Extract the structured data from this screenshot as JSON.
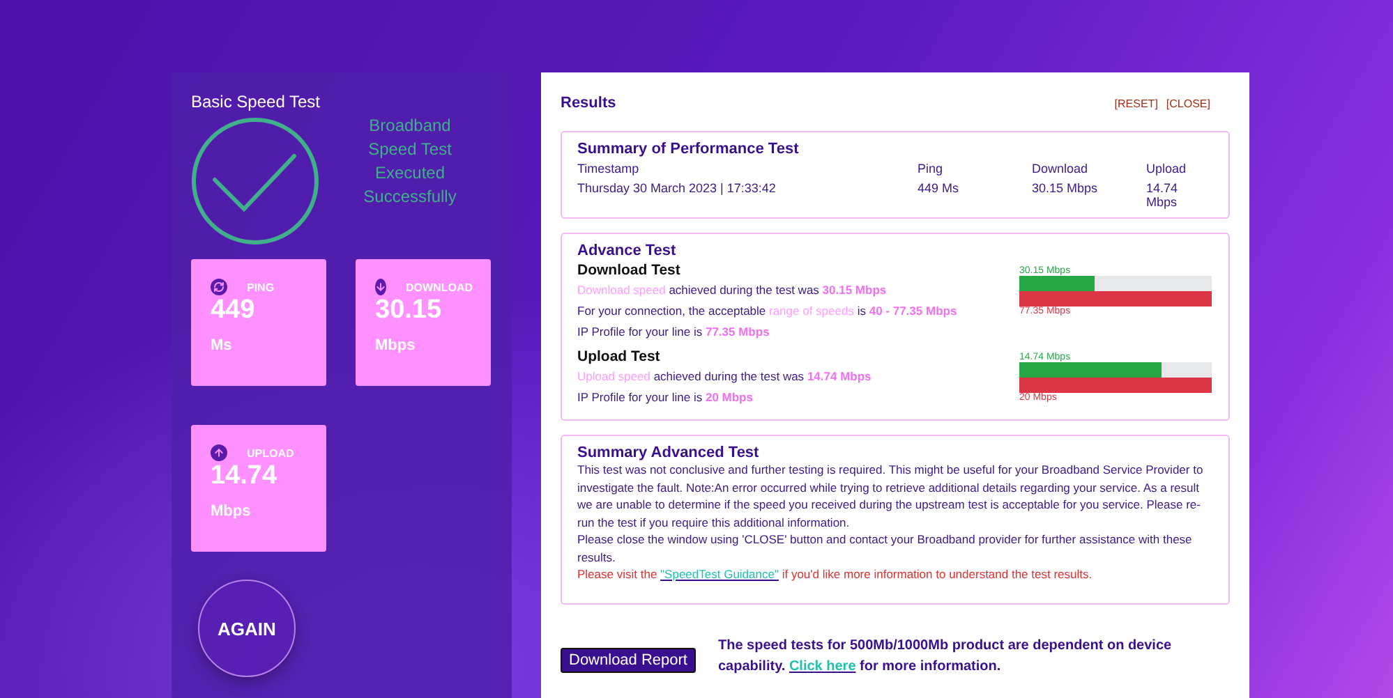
{
  "basic": {
    "title": "Basic Speed Test",
    "status_lines": [
      "Broadband",
      "Speed Test",
      "Executed",
      "Successfully"
    ],
    "tiles": [
      {
        "kind": "ping",
        "label": "PING",
        "value": "449",
        "unit": "Ms"
      },
      {
        "kind": "download",
        "label": "DOWNLOAD",
        "value": "30.15",
        "unit": "Mbps"
      },
      {
        "kind": "upload",
        "label": "UPLOAD",
        "value": "14.74",
        "unit": "Mbps"
      }
    ],
    "again_button": "AGAIN"
  },
  "results": {
    "title": "Results",
    "actions": [
      "[RESET]",
      "[CLOSE]"
    ],
    "summary": {
      "title": "Summary of Performance Test",
      "columns": [
        "Timestamp",
        "Ping",
        "Download",
        "Upload"
      ],
      "values": [
        "Thursday 30 March 2023 | 17:33:42",
        "449 Ms",
        "30.15 Mbps",
        "14.74 Mbps"
      ]
    },
    "advance": {
      "title": "Advance Test",
      "tests": [
        {
          "title": "Download Test",
          "lines": [
            [
              {
                "kind": "soft",
                "text": "Download speed"
              },
              {
                "kind": "plain",
                "text": " achieved during the test was "
              },
              {
                "kind": "value",
                "text": "30.15 Mbps"
              }
            ],
            [
              {
                "kind": "plain",
                "text": "For your connection, the acceptable "
              },
              {
                "kind": "soft",
                "text": "range of speeds"
              },
              {
                "kind": "plain",
                "text": " is "
              },
              {
                "kind": "value",
                "text": "40 - 77.35 Mbps"
              }
            ],
            [
              {
                "kind": "plain",
                "text": "IP Profile for your line is "
              },
              {
                "kind": "value",
                "text": "77.35 Mbps"
              }
            ]
          ],
          "achieved": {
            "label": "30.15 Mbps",
            "level": 0.39
          },
          "profile": {
            "label": "77.35 Mbps"
          }
        },
        {
          "title": "Upload Test",
          "lines": [
            [
              {
                "kind": "soft",
                "text": "Upload speed"
              },
              {
                "kind": "plain",
                "text": " achieved during the test was "
              },
              {
                "kind": "value",
                "text": "14.74 Mbps"
              }
            ],
            [
              {
                "kind": "plain",
                "text": "IP Profile for your line is "
              },
              {
                "kind": "value",
                "text": "20 Mbps"
              }
            ]
          ],
          "achieved": {
            "label": "14.74 Mbps",
            "level": 0.74
          },
          "profile": {
            "label": "20 Mbps"
          }
        }
      ]
    },
    "summary_advanced": {
      "title": "Summary Advanced Test",
      "paragraphs": [
        [
          {
            "kind": "plain",
            "text": "This test was not conclusive and further testing is required. This might be useful for your Broadband Service Provider to investigate the fault. Note:An error occurred while trying to retrieve additional details regarding your service. As a result we are unable to determine if the speed you received during the upstream test is acceptable for you service. Please re-run the test if you require this additional information."
          }
        ],
        [
          {
            "kind": "plain",
            "text": "Please close the window using 'CLOSE' button and contact your Broadband provider for further assistance with these results."
          }
        ],
        [
          {
            "kind": "alert",
            "text": "Please visit the "
          },
          {
            "kind": "link",
            "text": "\"SpeedTest Guidance\""
          },
          {
            "kind": "alert",
            "text": " if you'd like more information to understand the test results."
          }
        ]
      ]
    },
    "download_report": "Download Report",
    "note": [
      {
        "kind": "plain",
        "text": "The speed tests for 500Mb/1000Mb product are dependent on device capability. "
      },
      {
        "kind": "link",
        "text": "Click here"
      },
      {
        "kind": "plain",
        "text": " for more information."
      }
    ]
  }
}
